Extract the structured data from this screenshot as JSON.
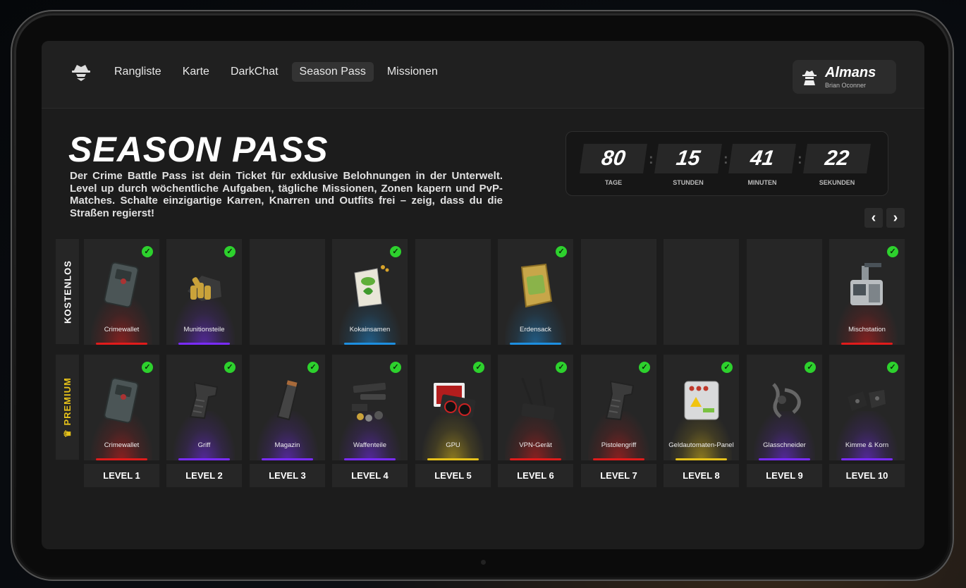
{
  "nav": {
    "items": [
      "Rangliste",
      "Karte",
      "DarkChat",
      "Season Pass",
      "Missionen"
    ],
    "active": "Season Pass"
  },
  "user": {
    "name": "Almans",
    "subtitle": "Brian Oconner"
  },
  "hero": {
    "title": "SEASON PASS",
    "description": "Der Crime Battle Pass ist dein Ticket für exklusive Belohnungen in der Unterwelt. Level up durch wöchentliche Aufgaben, tägliche Missionen, Zonen kapern und PvP-Matches. Schalte einzigartige Karren, Knarren und Outfits frei – zeig, dass du die Straßen regierst!"
  },
  "timer": {
    "days": "80",
    "days_label": "TAGE",
    "hours": "15",
    "hours_label": "STUNDEN",
    "minutes": "41",
    "minutes_label": "MINUTEN",
    "seconds": "22",
    "seconds_label": "SEKUNDEN"
  },
  "rows": {
    "free_label": "KOSTENLOS",
    "premium_label": "PREMIUM"
  },
  "colors": {
    "red": "#e01b1b",
    "purple": "#7a2bff",
    "blue": "#1d8fe0",
    "yellow": "#e6c21a",
    "check": "#2dd12d"
  },
  "free_items": [
    {
      "name": "Crimewallet",
      "rarity": "red",
      "claimed": true,
      "icon": "wallet-icon"
    },
    {
      "name": "Munitionsteile",
      "rarity": "purple",
      "claimed": true,
      "icon": "ammo-icon"
    },
    {
      "name": "",
      "rarity": "",
      "claimed": false,
      "icon": ""
    },
    {
      "name": "Kokainsamen",
      "rarity": "blue",
      "claimed": true,
      "icon": "seed-bag-icon"
    },
    {
      "name": "",
      "rarity": "",
      "claimed": false,
      "icon": ""
    },
    {
      "name": "Erdensack",
      "rarity": "blue",
      "claimed": true,
      "icon": "soil-bag-icon"
    },
    {
      "name": "",
      "rarity": "",
      "claimed": false,
      "icon": ""
    },
    {
      "name": "",
      "rarity": "",
      "claimed": false,
      "icon": ""
    },
    {
      "name": "",
      "rarity": "",
      "claimed": false,
      "icon": ""
    },
    {
      "name": "Mischstation",
      "rarity": "red",
      "claimed": true,
      "icon": "mixing-station-icon"
    }
  ],
  "premium_items": [
    {
      "name": "Crimewallet",
      "rarity": "red",
      "claimed": true,
      "icon": "wallet-icon"
    },
    {
      "name": "Griff",
      "rarity": "purple",
      "claimed": true,
      "icon": "grip-icon"
    },
    {
      "name": "Magazin",
      "rarity": "purple",
      "claimed": true,
      "icon": "magazine-icon"
    },
    {
      "name": "Waffenteile",
      "rarity": "purple",
      "claimed": true,
      "icon": "weapon-parts-icon"
    },
    {
      "name": "GPU",
      "rarity": "yellow",
      "claimed": true,
      "icon": "gpu-icon"
    },
    {
      "name": "VPN-Gerät",
      "rarity": "red",
      "claimed": true,
      "icon": "router-icon"
    },
    {
      "name": "Pistolengriff",
      "rarity": "red",
      "claimed": true,
      "icon": "pistol-grip-icon"
    },
    {
      "name": "Geldautomaten-Panel",
      "rarity": "yellow",
      "claimed": true,
      "icon": "atm-panel-icon"
    },
    {
      "name": "Glasschneider",
      "rarity": "purple",
      "claimed": true,
      "icon": "glass-cutter-icon"
    },
    {
      "name": "Kimme & Korn",
      "rarity": "purple",
      "claimed": true,
      "icon": "sights-icon"
    }
  ],
  "levels": [
    "LEVEL 1",
    "LEVEL 2",
    "LEVEL 3",
    "LEVEL 4",
    "LEVEL 5",
    "LEVEL 6",
    "LEVEL 7",
    "LEVEL 8",
    "LEVEL 9",
    "LEVEL 10"
  ]
}
